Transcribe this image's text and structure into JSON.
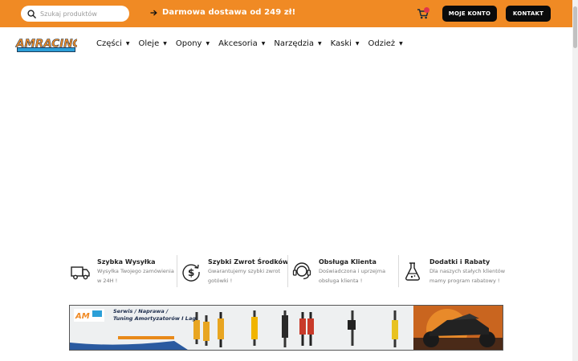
{
  "topbar": {
    "search_placeholder": "Szukaj produktów",
    "promo_text": "Darmowa dostawa od 249 zł!",
    "account_button": "MOJE KONTO",
    "contact_button": "KONTAKT",
    "icons": {
      "search": "search-icon",
      "promo": "arrow-right-icon",
      "cart": "cart-icon"
    }
  },
  "logo": {
    "text": "AMRACING.PL"
  },
  "nav": {
    "items": [
      {
        "label": "Części"
      },
      {
        "label": "Oleje"
      },
      {
        "label": "Opony"
      },
      {
        "label": "Akcesoria"
      },
      {
        "label": "Narzędzia"
      },
      {
        "label": "Kaski"
      },
      {
        "label": "Odzież"
      }
    ]
  },
  "features": [
    {
      "title": "Szybka Wysyłka",
      "desc": "Wysyłka Twojego zamówienia w 24H !",
      "icon": "truck-icon"
    },
    {
      "title": "Szybki Zwrot Środków",
      "desc": "Gwarantujemy szybki zwrot gotówki !",
      "icon": "money-return-icon"
    },
    {
      "title": "Obsługa Klienta",
      "desc": "Doświadczona i uprzejma obsługa klienta !",
      "icon": "headset-icon"
    },
    {
      "title": "Dodatki i Rabaty",
      "desc": "Dla naszych stałych klientów mamy program rabatowy !",
      "icon": "gift-icon"
    }
  ],
  "banner": {
    "line1": "Serwis / Naprawa /",
    "line2": "Tuning Amortyzatorów I Lag"
  },
  "colors": {
    "accent": "#f08a24",
    "dark": "#0b0b0b",
    "badge": "#e0334c"
  }
}
